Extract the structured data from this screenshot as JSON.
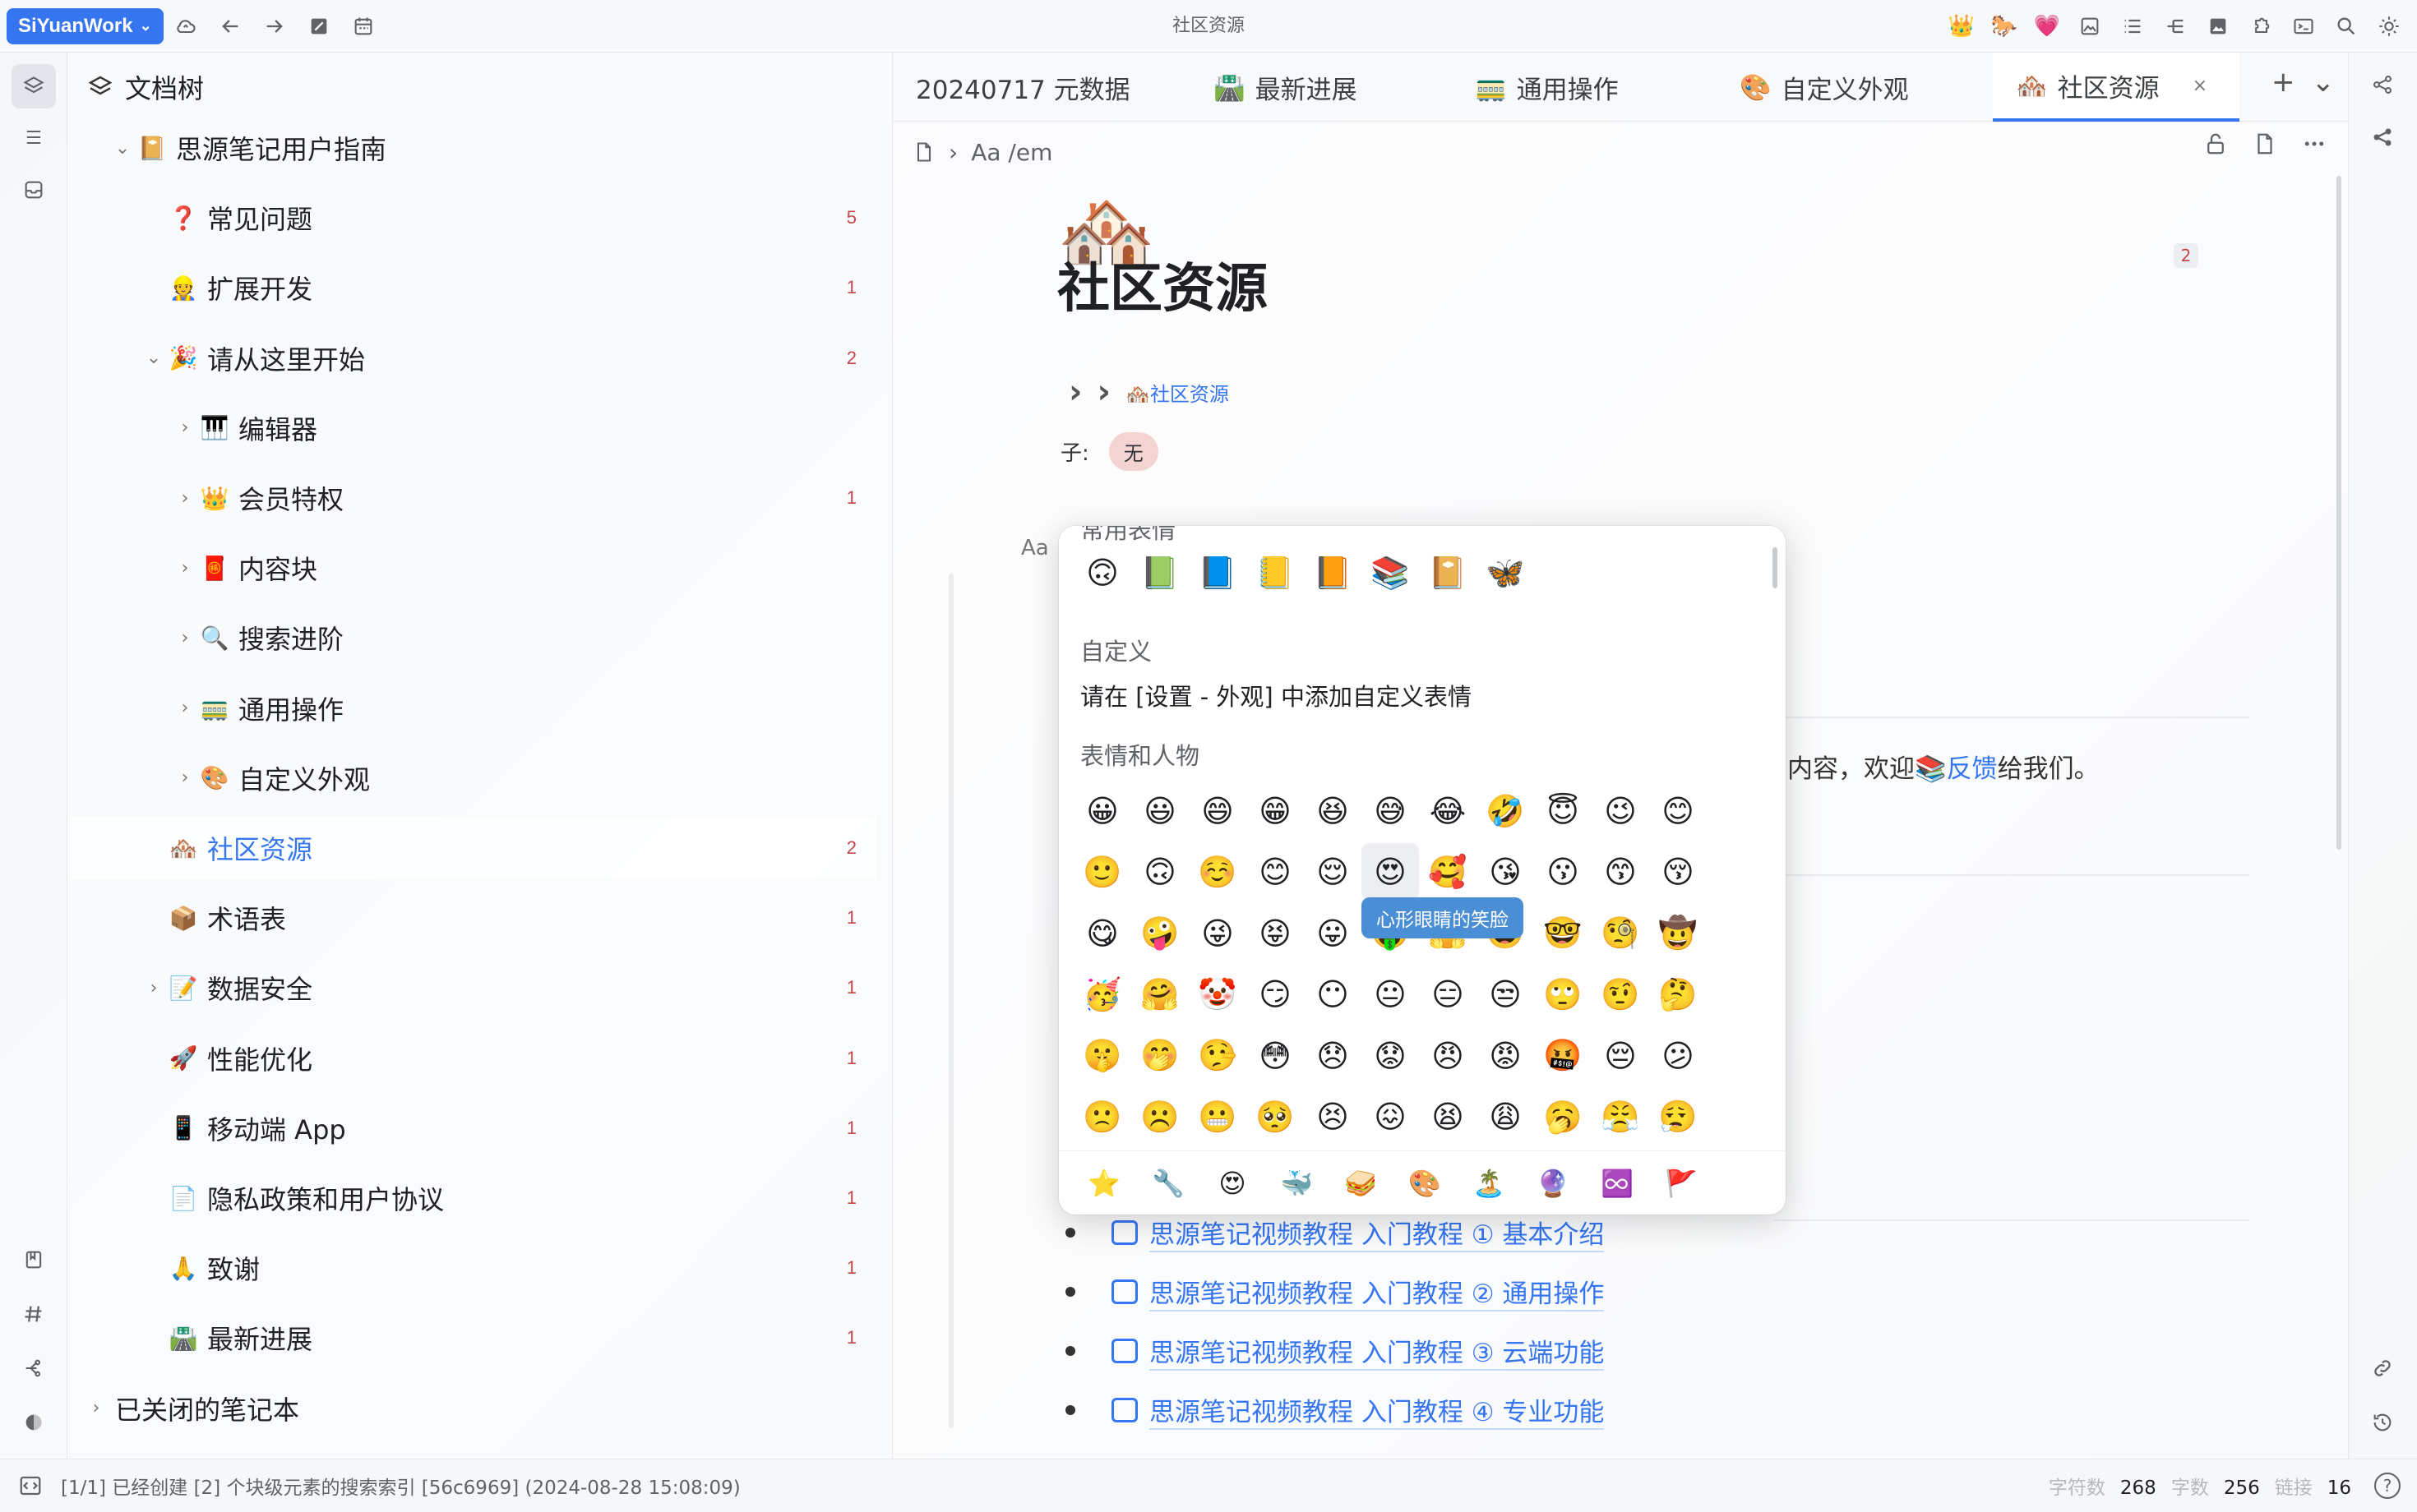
{
  "app": {
    "brand": "SiYuanWork",
    "window_title": "社区资源"
  },
  "tree": {
    "header": "文档树",
    "items": [
      {
        "label": "思源笔记用户指南",
        "icon": "📔",
        "count": "",
        "indent": 0,
        "arrow": "expanded"
      },
      {
        "label": "常见问题",
        "icon": "❓",
        "count": "5",
        "indent": 1,
        "arrow": "none"
      },
      {
        "label": "扩展开发",
        "icon": "👷",
        "count": "1",
        "indent": 1,
        "arrow": "none"
      },
      {
        "label": "请从这里开始",
        "icon": "🎉",
        "count": "2",
        "indent": 1,
        "arrow": "expanded"
      },
      {
        "label": "编辑器",
        "icon": "🎹",
        "count": "",
        "indent": 2,
        "arrow": "collapsed"
      },
      {
        "label": "会员特权",
        "icon": "👑",
        "count": "1",
        "indent": 2,
        "arrow": "collapsed"
      },
      {
        "label": "内容块",
        "icon": "🧧",
        "count": "",
        "indent": 2,
        "arrow": "collapsed"
      },
      {
        "label": "搜索进阶",
        "icon": "🔍",
        "count": "",
        "indent": 2,
        "arrow": "collapsed"
      },
      {
        "label": "通用操作",
        "icon": "🚃",
        "count": "",
        "indent": 2,
        "arrow": "collapsed"
      },
      {
        "label": "自定义外观",
        "icon": "🎨",
        "count": "",
        "indent": 2,
        "arrow": "collapsed"
      },
      {
        "label": "社区资源",
        "icon": "🏘️",
        "count": "2",
        "indent": 1,
        "arrow": "none",
        "selected": true
      },
      {
        "label": "术语表",
        "icon": "📦",
        "count": "1",
        "indent": 1,
        "arrow": "none"
      },
      {
        "label": "数据安全",
        "icon": "📝",
        "count": "1",
        "indent": 1,
        "arrow": "collapsed"
      },
      {
        "label": "性能优化",
        "icon": "🚀",
        "count": "1",
        "indent": 1,
        "arrow": "none"
      },
      {
        "label": "移动端 App",
        "icon": "📱",
        "count": "1",
        "indent": 1,
        "arrow": "none"
      },
      {
        "label": "隐私政策和用户协议",
        "icon": "📄",
        "count": "1",
        "indent": 1,
        "arrow": "none"
      },
      {
        "label": "致谢",
        "icon": "🙏",
        "count": "1",
        "indent": 1,
        "arrow": "none"
      },
      {
        "label": "最新进展",
        "icon": "🛣️",
        "count": "1",
        "indent": 1,
        "arrow": "none"
      },
      {
        "label": "已关闭的笔记本",
        "icon": "",
        "count": "",
        "indent": -1,
        "arrow": "collapsed"
      }
    ]
  },
  "tabs": [
    {
      "label": "20240717 元数据",
      "icon": ""
    },
    {
      "label": "最新进展",
      "icon": "🛣️"
    },
    {
      "label": "通用操作",
      "icon": "🚃"
    },
    {
      "label": "自定义外观",
      "icon": "🎨"
    },
    {
      "label": "社区资源",
      "icon": "🏘️",
      "active": true,
      "close": "×"
    }
  ],
  "tab_actions": {
    "add": "+",
    "more": "⌄"
  },
  "breadcrumb": {
    "path": "Aa /em"
  },
  "doc": {
    "icon": "🏘️",
    "title": "社区资源",
    "badge": "2",
    "path_chev": "›",
    "path_link": "🏘️社区资源",
    "child_label": "子:",
    "child_value": "无",
    "input_prefix": "Aa",
    "input_text": ":",
    "snippet_pre": "内容，欢迎",
    "snippet_icon": "📚",
    "snippet_link": "反馈",
    "snippet_post": "给我们。",
    "videos": [
      "思源笔记视频教程 入门教程 ① 基本介绍",
      "思源笔记视频教程 入门教程 ② 通用操作",
      "思源笔记视频教程 入门教程 ③ 云端功能",
      "思源笔记视频教程 入门教程 ④ 专业功能"
    ]
  },
  "emoji_picker": {
    "recent_title": "常用表情",
    "recent": [
      "🙃",
      "📗",
      "📘",
      "📒",
      "📙",
      "📚",
      "📔",
      "🦋"
    ],
    "custom_title": "自定义",
    "custom_hint": "请在 [设置 - 外观] 中添加自定义表情",
    "people_title": "表情和人物",
    "rows": [
      [
        "😀",
        "😃",
        "😄",
        "😁",
        "😆",
        "😅",
        "😂",
        "🤣",
        "😇",
        "😉",
        "😊"
      ],
      [
        "🙂",
        "🙃",
        "☺️",
        "😊",
        "😌",
        "😍",
        "🥰",
        "😘",
        "😗",
        "😙",
        "😚"
      ],
      [
        "😋",
        "🤪",
        "😜",
        "😝",
        "😛",
        "🤑",
        "🤗",
        "🤓",
        "🤓",
        "🧐",
        "🤠"
      ],
      [
        "🥳",
        "🤗",
        "🤡",
        "😏",
        "😶",
        "😐",
        "😑",
        "😒",
        "🙄",
        "🤨",
        "🤔"
      ],
      [
        "🤫",
        "🤭",
        "🤥",
        "😳",
        "😞",
        "😟",
        "😠",
        "😡",
        "🤬",
        "😔",
        "😕"
      ],
      [
        "🙁",
        "☹️",
        "😬",
        "🥺",
        "😣",
        "😖",
        "😫",
        "😩",
        "🥱",
        "😤",
        "😮‍💨"
      ],
      [
        "😦",
        "😰",
        "😨",
        "😱",
        "😥",
        "😓",
        "😪",
        "😴",
        "😵",
        "😲",
        "🤐"
      ]
    ],
    "hovered_row": 1,
    "hovered_col": 5,
    "tooltip": "心形眼睛的笑脸",
    "categories": [
      "⭐",
      "🔧",
      "😍",
      "🐳",
      "🥪",
      "🎨",
      "🏝️",
      "🔮",
      "♾️",
      "🚩"
    ]
  },
  "status": {
    "message": "[1/1] 已经创建 [2] 个块级元素的搜索索引 [56c6969] (2024-08-28 15:08:09)",
    "char_label": "字符数",
    "char_value": "268",
    "word_label": "字数",
    "word_value": "256",
    "link_label": "链接",
    "link_value": "16",
    "help": "?"
  }
}
